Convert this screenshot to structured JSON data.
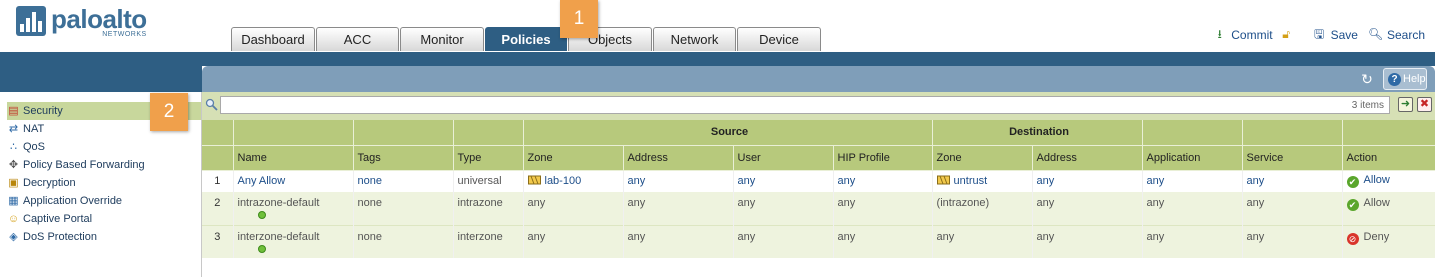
{
  "brand": {
    "name": "paloalto",
    "sub": "NETWORKS"
  },
  "tabs": [
    {
      "label": "Dashboard",
      "active": false
    },
    {
      "label": "ACC",
      "active": false
    },
    {
      "label": "Monitor",
      "active": false
    },
    {
      "label": "Policies",
      "active": true
    },
    {
      "label": "Objects",
      "active": false
    },
    {
      "label": "Network",
      "active": false
    },
    {
      "label": "Device",
      "active": false
    }
  ],
  "callouts": [
    "1",
    "2"
  ],
  "header_actions": {
    "commit": "Commit",
    "save": "Save",
    "search": "Search"
  },
  "help_label": "Help",
  "sidebar": {
    "items": [
      {
        "label": "Security",
        "icon": "security-icon",
        "active": true
      },
      {
        "label": "NAT",
        "icon": "nat-icon"
      },
      {
        "label": "QoS",
        "icon": "qos-icon"
      },
      {
        "label": "Policy Based Forwarding",
        "icon": "pbf-icon"
      },
      {
        "label": "Decryption",
        "icon": "lock-icon"
      },
      {
        "label": "Application Override",
        "icon": "app-override-icon"
      },
      {
        "label": "Captive Portal",
        "icon": "user-icon"
      },
      {
        "label": "DoS Protection",
        "icon": "shield-icon"
      }
    ]
  },
  "filter": {
    "value": "",
    "count": "3 items"
  },
  "table": {
    "groups": {
      "source": "Source",
      "destination": "Destination"
    },
    "columns": [
      "Name",
      "Tags",
      "Type",
      "Zone",
      "Address",
      "User",
      "HIP Profile",
      "Zone",
      "Address",
      "Application",
      "Service",
      "Action"
    ],
    "rows": [
      {
        "idx": "1",
        "name": "Any Allow",
        "tags": "none",
        "type": "universal",
        "src_zone": "lab-100",
        "src_addr": "any",
        "user": "any",
        "hip": "any",
        "dst_zone": "untrust",
        "dst_addr": "any",
        "app": "any",
        "service": "any",
        "action": "Allow"
      },
      {
        "idx": "2",
        "name": "intrazone-default",
        "tags": "none",
        "type": "intrazone",
        "src_zone": "any",
        "src_addr": "any",
        "user": "any",
        "hip": "any",
        "dst_zone": "(intrazone)",
        "dst_addr": "any",
        "app": "any",
        "service": "any",
        "action": "Allow"
      },
      {
        "idx": "3",
        "name": "interzone-default",
        "tags": "none",
        "type": "interzone",
        "src_zone": "any",
        "src_addr": "any",
        "user": "any",
        "hip": "any",
        "dst_zone": "any",
        "dst_addr": "any",
        "app": "any",
        "service": "any",
        "action": "Deny"
      }
    ]
  },
  "colors": {
    "nav_band": "#2e5e83",
    "panel_bar": "#7f9eb9",
    "table_header": "#b7c97c",
    "callout": "#f0a04b",
    "link": "#1d4e89"
  }
}
